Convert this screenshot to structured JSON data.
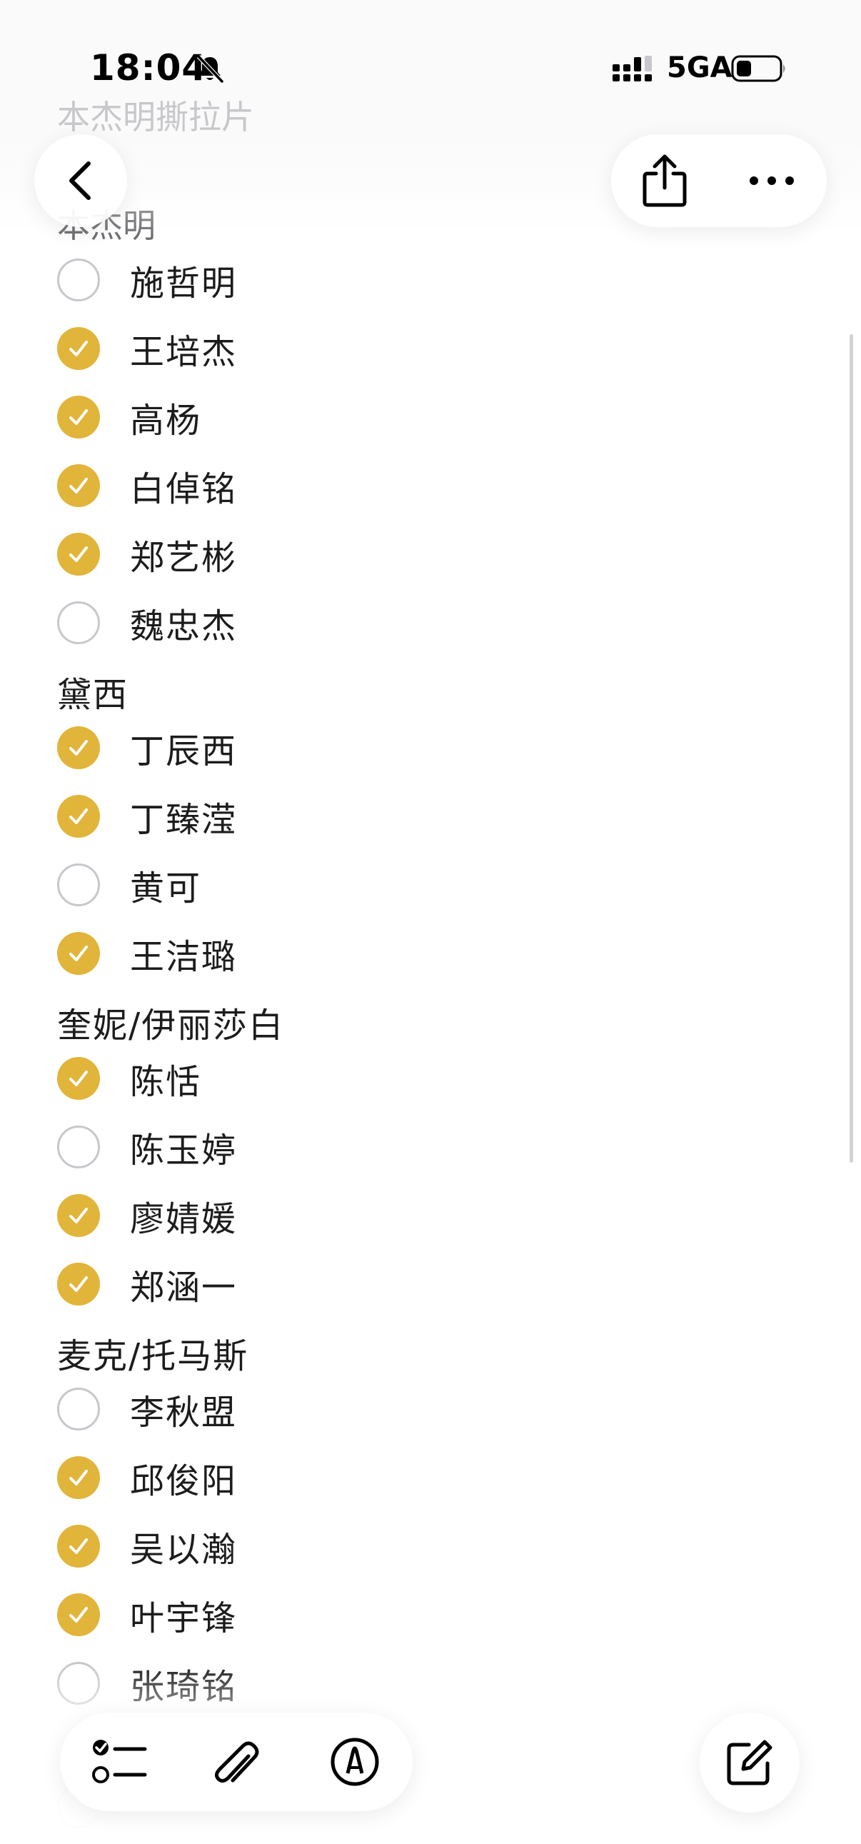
{
  "status_bar": {
    "time": "18:04",
    "network": "5GA",
    "icons": [
      "bell-slash-icon",
      "signal-icon",
      "battery-icon"
    ]
  },
  "note": {
    "title": "本杰明撕拉片",
    "peek_header": "本杰明"
  },
  "nav": {
    "icons": [
      "chevron-left-icon",
      "share-icon",
      "more-icon"
    ]
  },
  "colors": {
    "checked": "#e1b43a",
    "unchecked_border": "#c7c7cc",
    "text": "#1c1c1e"
  },
  "sections": [
    {
      "items": [
        {
          "label": "施哲明",
          "checked": false
        },
        {
          "label": "王培杰",
          "checked": true
        },
        {
          "label": "高杨",
          "checked": true
        },
        {
          "label": "白倬铭",
          "checked": true
        },
        {
          "label": "郑艺彬",
          "checked": true
        },
        {
          "label": "魏忠杰",
          "checked": false
        }
      ]
    },
    {
      "header": "黛西",
      "items": [
        {
          "label": "丁辰西",
          "checked": true
        },
        {
          "label": "丁臻滢",
          "checked": true
        },
        {
          "label": "黄可",
          "checked": false
        },
        {
          "label": "王洁璐",
          "checked": true
        }
      ]
    },
    {
      "header": "奎妮/伊丽莎白",
      "items": [
        {
          "label": "陈恬",
          "checked": true
        },
        {
          "label": "陈玉婷",
          "checked": false
        },
        {
          "label": "廖婧媛",
          "checked": true
        },
        {
          "label": "郑涵一",
          "checked": true
        }
      ]
    },
    {
      "header": "麦克/托马斯",
      "items": [
        {
          "label": "李秋盟",
          "checked": false
        },
        {
          "label": "邱俊阳",
          "checked": true
        },
        {
          "label": "吴以瀚",
          "checked": true
        },
        {
          "label": "叶宇锋",
          "checked": true
        },
        {
          "label": "张琦铭",
          "checked": false
        }
      ]
    }
  ],
  "toolbar": {
    "icons": [
      "checklist-icon",
      "paperclip-icon",
      "markup-icon",
      "compose-icon"
    ]
  }
}
